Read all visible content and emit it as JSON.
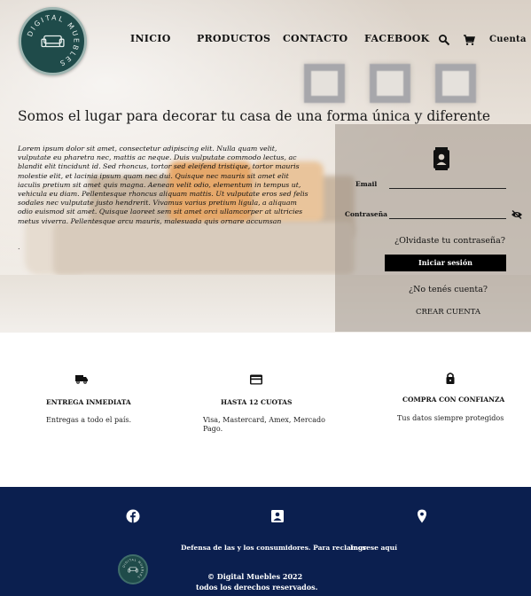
{
  "brand": {
    "logo_text": "DIGITAL MUEBLES",
    "accent": "#1f4b4a"
  },
  "nav": {
    "links": [
      "INICIO",
      "PRODUCTOS",
      "CONTACTO",
      "FACEBOOK"
    ],
    "icons": [
      "search-icon",
      "cart-icon"
    ],
    "account_label": "Cuenta"
  },
  "hero": {
    "title": "Somos el lugar para decorar tu casa de una forma única y diferente",
    "body": "Lorem ipsum dolor sit amet, consectetur adipiscing elit. Nulla quam velit, vulputate eu pharetra nec, mattis ac neque. Duis vulputate commodo lectus, ac blandit elit tincidunt id. Sed rhoncus, tortor sed eleifend tristique, tortor mauris molestie elit, et lacinia ipsum quam nec dui. Quisque nec mauris sit amet elit iaculis pretium sit amet quis magna. Aenean velit odio, elementum in tempus ut, vehicula eu diam. Pellentesque rhoncus aliquam mattis. Ut vulputate eros sed felis sodales nec vulputate justo hendrerit. Vivamus varius pretium ligula, a aliquam odio euismod sit amet. Quisque laoreet sem sit amet orci ullamcorper at ultricies metus viverra. Pellentesque arcu mauris, malesuada quis ornare accumsan",
    "dot": "."
  },
  "login": {
    "email_label": "Email",
    "password_label": "Contraseña",
    "forgot": "¿Olvidaste tu contraseña?",
    "submit": "Iniciar sesión",
    "no_account": "¿No tenés cuenta?",
    "create": "CREAR CUENTA"
  },
  "features": [
    {
      "icon": "truck-icon",
      "title": "ENTREGA INMEDIATA",
      "text": "Entregas a todo el país."
    },
    {
      "icon": "credit-card-icon",
      "title": "HASTA 12 CUOTAS",
      "text": "Visa, Mastercard, Amex, Mercado Pago."
    },
    {
      "icon": "lock-icon",
      "title": "COMPRA CON CONFIANZA",
      "text": "Tus datos siempre protegidos"
    }
  ],
  "footer": {
    "icons": [
      "facebook-icon",
      "contact-icon",
      "location-icon"
    ],
    "consumer_text": "Defensa de las y los consumidores. Para reclamos",
    "consumer_link": "Ingrese aquí",
    "copyright": "© Digital Muebles 2022",
    "rights": "todos los derechos reservados.",
    "background": "#0b1f4f"
  }
}
